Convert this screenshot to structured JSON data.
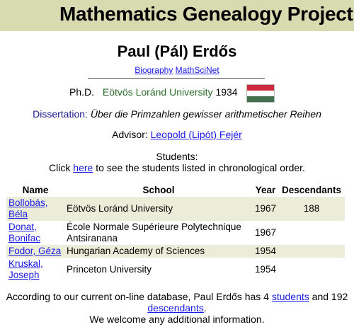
{
  "site": {
    "title": "Mathematics Genealogy Project"
  },
  "person": {
    "name": "Paul (Pál) Erdős",
    "links": [
      "Biography",
      "MathSciNet"
    ],
    "degree": "Ph.D.",
    "university": "Eötvös Loránd University",
    "year": "1934",
    "flag": {
      "country": "Hungary",
      "colors": [
        "#cd2a3e",
        "#ffffff",
        "#436f4d"
      ]
    },
    "dissertation_label": "Dissertation:",
    "dissertation_title": "Über die Primzahlen gewisser arithmetischer Reihen",
    "advisor_label": "Advisor:",
    "advisor": "Leopold (Lipót) Fejér"
  },
  "students_section": {
    "heading": "Students:",
    "click_pre": "Click",
    "click_link": "here",
    "click_post": "to see the students listed in chronological order."
  },
  "table": {
    "headers": [
      "Name",
      "School",
      "Year",
      "Descendants"
    ],
    "rows": [
      {
        "name_line1": "Bollobás,",
        "name_line2": "Béla",
        "school_line1": "Eötvös Loránd University",
        "school_line2": "",
        "year": "1967",
        "descendants": "188"
      },
      {
        "name_line1": "Donat,",
        "name_line2": "Bonifac",
        "school_line1": "École Normale Supérieure Polytechnique",
        "school_line2": "Antsiranana",
        "year": "1967",
        "descendants": ""
      },
      {
        "name_line1": "Fodor, Géza",
        "name_line2": "",
        "school_line1": "Hungarian Academy of Sciences",
        "school_line2": "",
        "year": "1954",
        "descendants": ""
      },
      {
        "name_line1": "Kruskal,",
        "name_line2": "Joseph",
        "school_line1": "Princeton University",
        "school_line2": "",
        "year": "1954",
        "descendants": ""
      }
    ]
  },
  "footer": {
    "text1": "According to our current on-line database, Paul Erdős has 4",
    "students_link": "students",
    "text2": "and 192",
    "descendants_link": "descendants",
    "text3": ".",
    "line2": "We welcome any additional information."
  }
}
